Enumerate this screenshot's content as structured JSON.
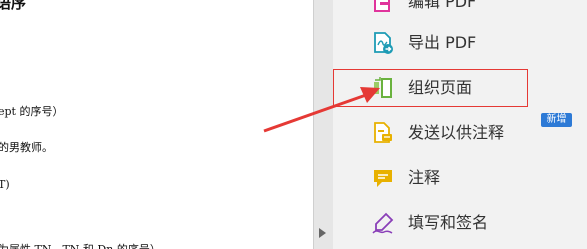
{
  "document": {
    "heading_fragment": "语序",
    "lines": [
      "ept 的序号）",
      "的男教师。",
      "T)",
      "为属性 TN、TN 和 Dn 的序号）"
    ]
  },
  "panel": {
    "items": [
      {
        "label": "编辑 PDF",
        "icon": "edit-pdf-icon",
        "color": "#e0349c"
      },
      {
        "label": "导出 PDF",
        "icon": "export-pdf-icon",
        "color": "#1d9bb5"
      },
      {
        "label": "组织页面",
        "icon": "organize-pages-icon",
        "color": "#6ab23e"
      },
      {
        "label": "发送以供注释",
        "icon": "send-for-comment-icon",
        "color": "#e8b100"
      },
      {
        "label": "注释",
        "icon": "comment-icon",
        "color": "#e8b100"
      },
      {
        "label": "填写和签名",
        "icon": "fill-sign-icon",
        "color": "#8a3fb8"
      }
    ],
    "new_badge": "新增"
  },
  "colors": {
    "annotation_red": "#e53935",
    "badge_blue": "#2d7ad6"
  }
}
